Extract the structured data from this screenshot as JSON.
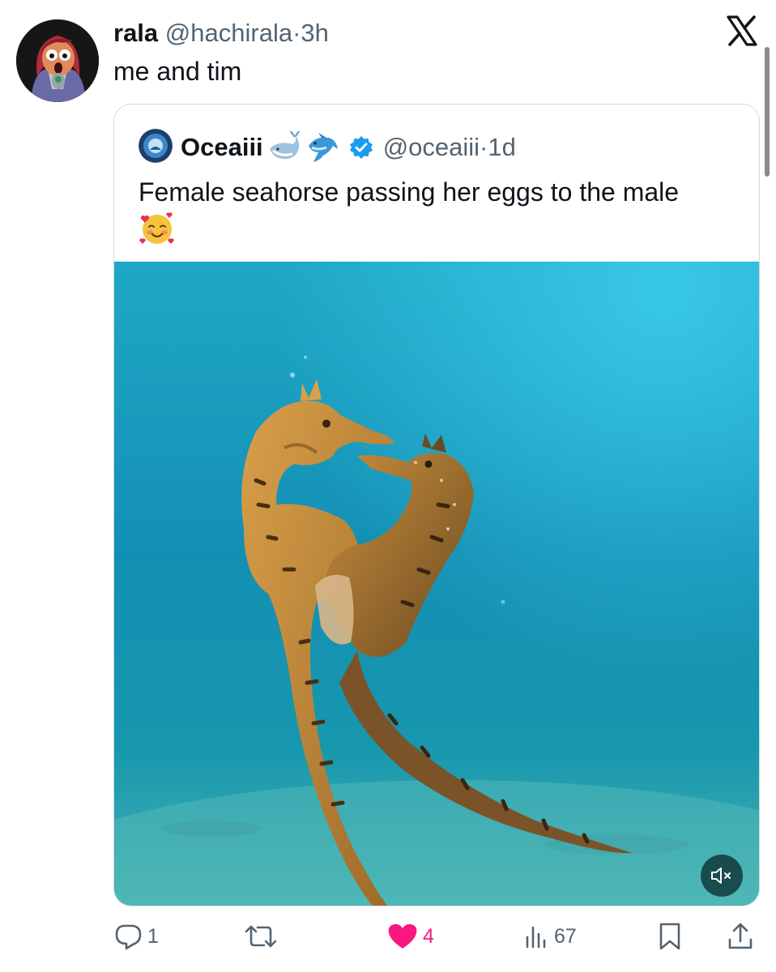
{
  "tweet": {
    "author_name": "rala",
    "author_handle": "@hachirala",
    "separator": "·",
    "time": "3h",
    "text": "me and tim"
  },
  "quoted": {
    "author_name": "Oceaiii",
    "name_emojis": [
      "whale-emoji",
      "dolphin-emoji"
    ],
    "verified": true,
    "author_handle": "@oceaiii",
    "separator": "·",
    "time": "1d",
    "text": "Female seahorse passing her eggs to the male",
    "trailing_emoji": "smiling-face-with-hearts-emoji",
    "media": {
      "type": "video",
      "muted": true,
      "mute_icon": "speaker-muted-icon"
    }
  },
  "actions": {
    "reply_count": "1",
    "repost_count": "",
    "like_count": "4",
    "liked": true,
    "view_count": "67"
  },
  "colors": {
    "text": "#0f1419",
    "secondary": "#536471",
    "like": "#f91880",
    "verified": "#1d9bf0",
    "border": "#cfd9de"
  },
  "icons": [
    "x-logo-icon",
    "reply-icon",
    "repost-icon",
    "heart-icon",
    "views-icon",
    "bookmark-icon",
    "share-icon",
    "verified-badge-icon"
  ]
}
